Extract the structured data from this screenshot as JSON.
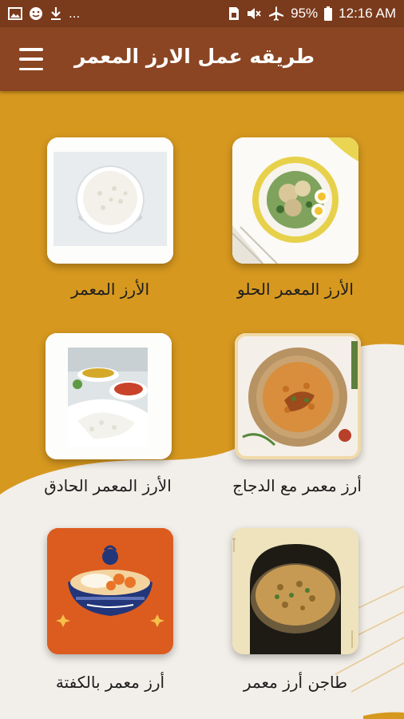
{
  "status_bar": {
    "left_icons": [
      "image-icon",
      "emoji-icon",
      "download-icon"
    ],
    "overflow": "...",
    "battery": "95%",
    "time": "12:16 AM"
  },
  "app_bar": {
    "title": "طريقه عمل الارز المعمر"
  },
  "recipes": [
    {
      "label": "الأرز المعمر الحلو"
    },
    {
      "label": "الأرز المعمر"
    },
    {
      "label": "أرز معمر مع الدجاج"
    },
    {
      "label": "الأرز المعمر الحادق"
    },
    {
      "label": "طاجن أرز معمر"
    },
    {
      "label": "أرز معمر بالكفتة"
    }
  ],
  "colors": {
    "status_bar": "#7a3a1c",
    "app_bar": "#8b4522",
    "mustard": "#d6981f",
    "cream": "#f2eee9"
  }
}
